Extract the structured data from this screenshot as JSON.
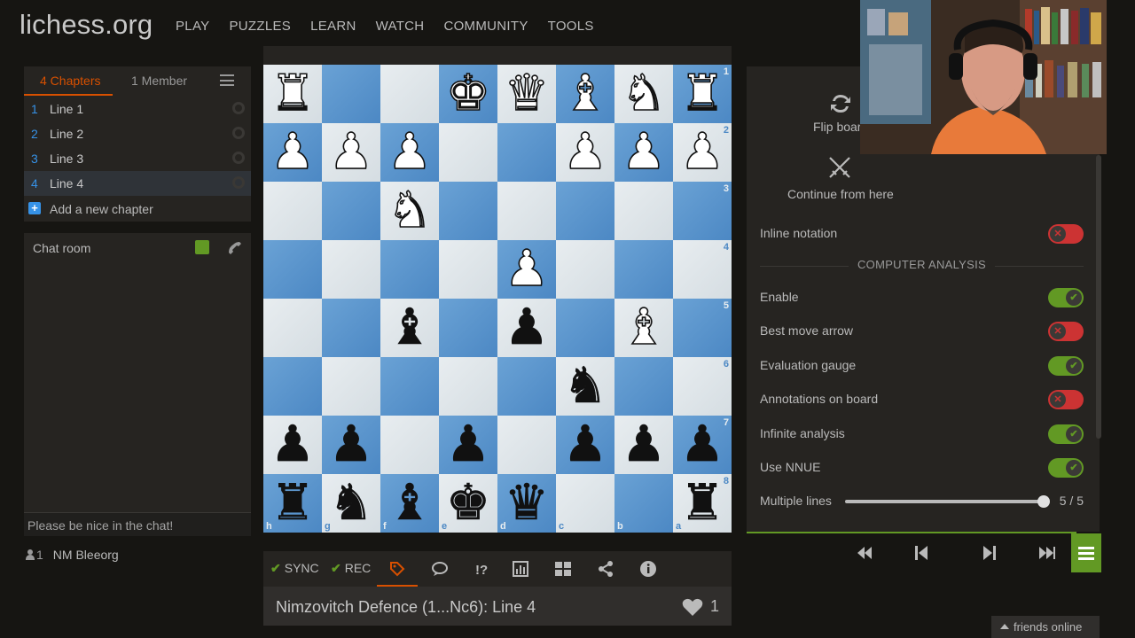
{
  "header": {
    "logo": "lichess.org",
    "nav": [
      "PLAY",
      "PUZZLES",
      "LEARN",
      "WATCH",
      "COMMUNITY",
      "TOOLS"
    ]
  },
  "study": {
    "tabs": {
      "chapters": "4 Chapters",
      "members": "1 Member"
    },
    "chapters": [
      {
        "num": "1",
        "label": "Line 1"
      },
      {
        "num": "2",
        "label": "Line 2"
      },
      {
        "num": "3",
        "label": "Line 3"
      },
      {
        "num": "4",
        "label": "Line 4"
      }
    ],
    "add_chapter": "Add a new chapter",
    "active_chapter": 4
  },
  "chat": {
    "title": "Chat room",
    "placeholder": "Please be nice in the chat!"
  },
  "members": {
    "count": "1",
    "name": "NM Bleeorg"
  },
  "board": {
    "orientation": "black",
    "ranks": [
      "1",
      "2",
      "3",
      "4",
      "5",
      "6",
      "7",
      "8"
    ],
    "files": [
      "h",
      "g",
      "f",
      "e",
      "d",
      "c",
      "b",
      "a"
    ],
    "rows": [
      [
        "wR",
        "",
        "",
        "wK",
        "wQ",
        "wB",
        "wN",
        "wR"
      ],
      [
        "wP",
        "wP",
        "wP",
        "",
        "",
        "wP",
        "wP",
        "wP"
      ],
      [
        "",
        "",
        "wN",
        "",
        "",
        "",
        "",
        ""
      ],
      [
        "",
        "",
        "",
        "",
        "wP",
        "",
        "",
        ""
      ],
      [
        "",
        "",
        "bB",
        "",
        "bP",
        "",
        "wB",
        ""
      ],
      [
        "",
        "",
        "",
        "",
        "",
        "bN",
        "",
        ""
      ],
      [
        "bP",
        "bP",
        "",
        "bP",
        "",
        "bP",
        "bP",
        "bP"
      ],
      [
        "bR",
        "bN",
        "bB",
        "bK",
        "bQ",
        "",
        "",
        "bR"
      ]
    ]
  },
  "toolbar": {
    "sync": "SYNC",
    "rec": "REC"
  },
  "study_title": "Nimzovitch Defence (1...Nc6): Line 4",
  "likes": "1",
  "tools": {
    "flip": "Flip board",
    "continue": "Continue from here",
    "inline_notation": {
      "label": "Inline notation",
      "on": false
    },
    "section_heading": "COMPUTER ANALYSIS",
    "settings": [
      {
        "label": "Enable",
        "on": true
      },
      {
        "label": "Best move arrow",
        "on": false
      },
      {
        "label": "Evaluation gauge",
        "on": true
      },
      {
        "label": "Annotations on board",
        "on": false
      },
      {
        "label": "Infinite analysis",
        "on": true
      },
      {
        "label": "Use NNUE",
        "on": true
      }
    ],
    "multiple_lines": {
      "label": "Multiple lines",
      "value": "5 / 5",
      "fraction": 1.0
    }
  },
  "friends": "friends online",
  "colors": {
    "accent": "#d85000",
    "green": "#629924",
    "blue": "#3692e7",
    "red": "#cc3333"
  }
}
